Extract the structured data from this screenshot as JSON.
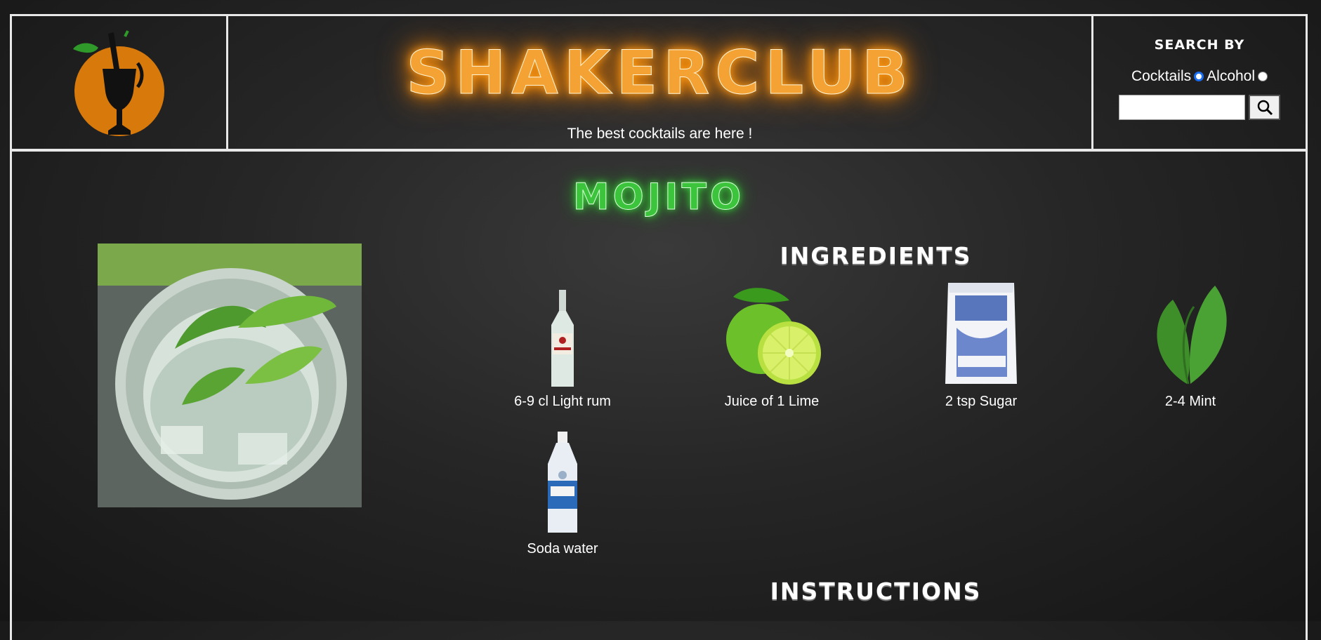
{
  "header": {
    "site_title": "SHAKERCLUB",
    "tagline": "The best cocktails are here !",
    "search": {
      "title": "SEARCH BY",
      "options": [
        {
          "label": "Cocktails",
          "selected": true
        },
        {
          "label": "Alcohol",
          "selected": false
        }
      ],
      "input_value": "",
      "button_icon": "search-icon"
    }
  },
  "drink": {
    "name": "MOJITO",
    "ingredients_title": "INGREDIENTS",
    "ingredients": [
      {
        "label": "6-9 cl Light rum",
        "icon": "rum-bottle"
      },
      {
        "label": "Juice of 1 Lime",
        "icon": "lime"
      },
      {
        "label": "2 tsp Sugar",
        "icon": "sugar-bag"
      },
      {
        "label": "2-4 Mint",
        "icon": "mint-leaves"
      },
      {
        "label": "Soda water",
        "icon": "soda-bottle"
      }
    ],
    "instructions_title": "INSTRUCTIONS",
    "instructions_text": ""
  },
  "colors": {
    "brand_orange": "#f4a234",
    "drink_green": "#3cc43c",
    "border": "#e8e8e8"
  }
}
